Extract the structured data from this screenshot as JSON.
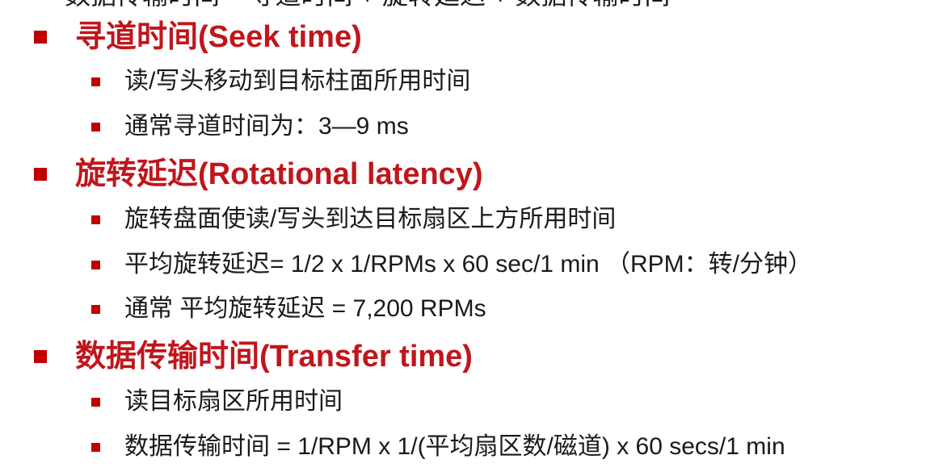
{
  "cutoff_text": "数据传输时间 = 寻道时间 + 旋转延迟 + 数据传输时间",
  "sections": [
    {
      "heading": "寻道时间(Seek time)",
      "items": [
        "读/写头移动到目标柱面所用时间",
        "通常寻道时间为：3—9 ms"
      ]
    },
    {
      "heading": "旋转延迟(Rotational latency)",
      "items": [
        "旋转盘面使读/写头到达目标扇区上方所用时间",
        "平均旋转延迟= 1/2 x 1/RPMs x 60 sec/1 min （RPM：转/分钟）",
        "通常 平均旋转延迟 = 7,200 RPMs"
      ]
    },
    {
      "heading": "数据传输时间(Transfer time)",
      "items": [
        "读目标扇区所用时间",
        "数据传输时间 = 1/RPM x 1/(平均扇区数/磁道) x 60 secs/1 min"
      ]
    }
  ],
  "colors": {
    "heading": "#c0161b",
    "bullet": "#c00000",
    "body_text": "#1a1a1a",
    "background": "#ffffff"
  }
}
